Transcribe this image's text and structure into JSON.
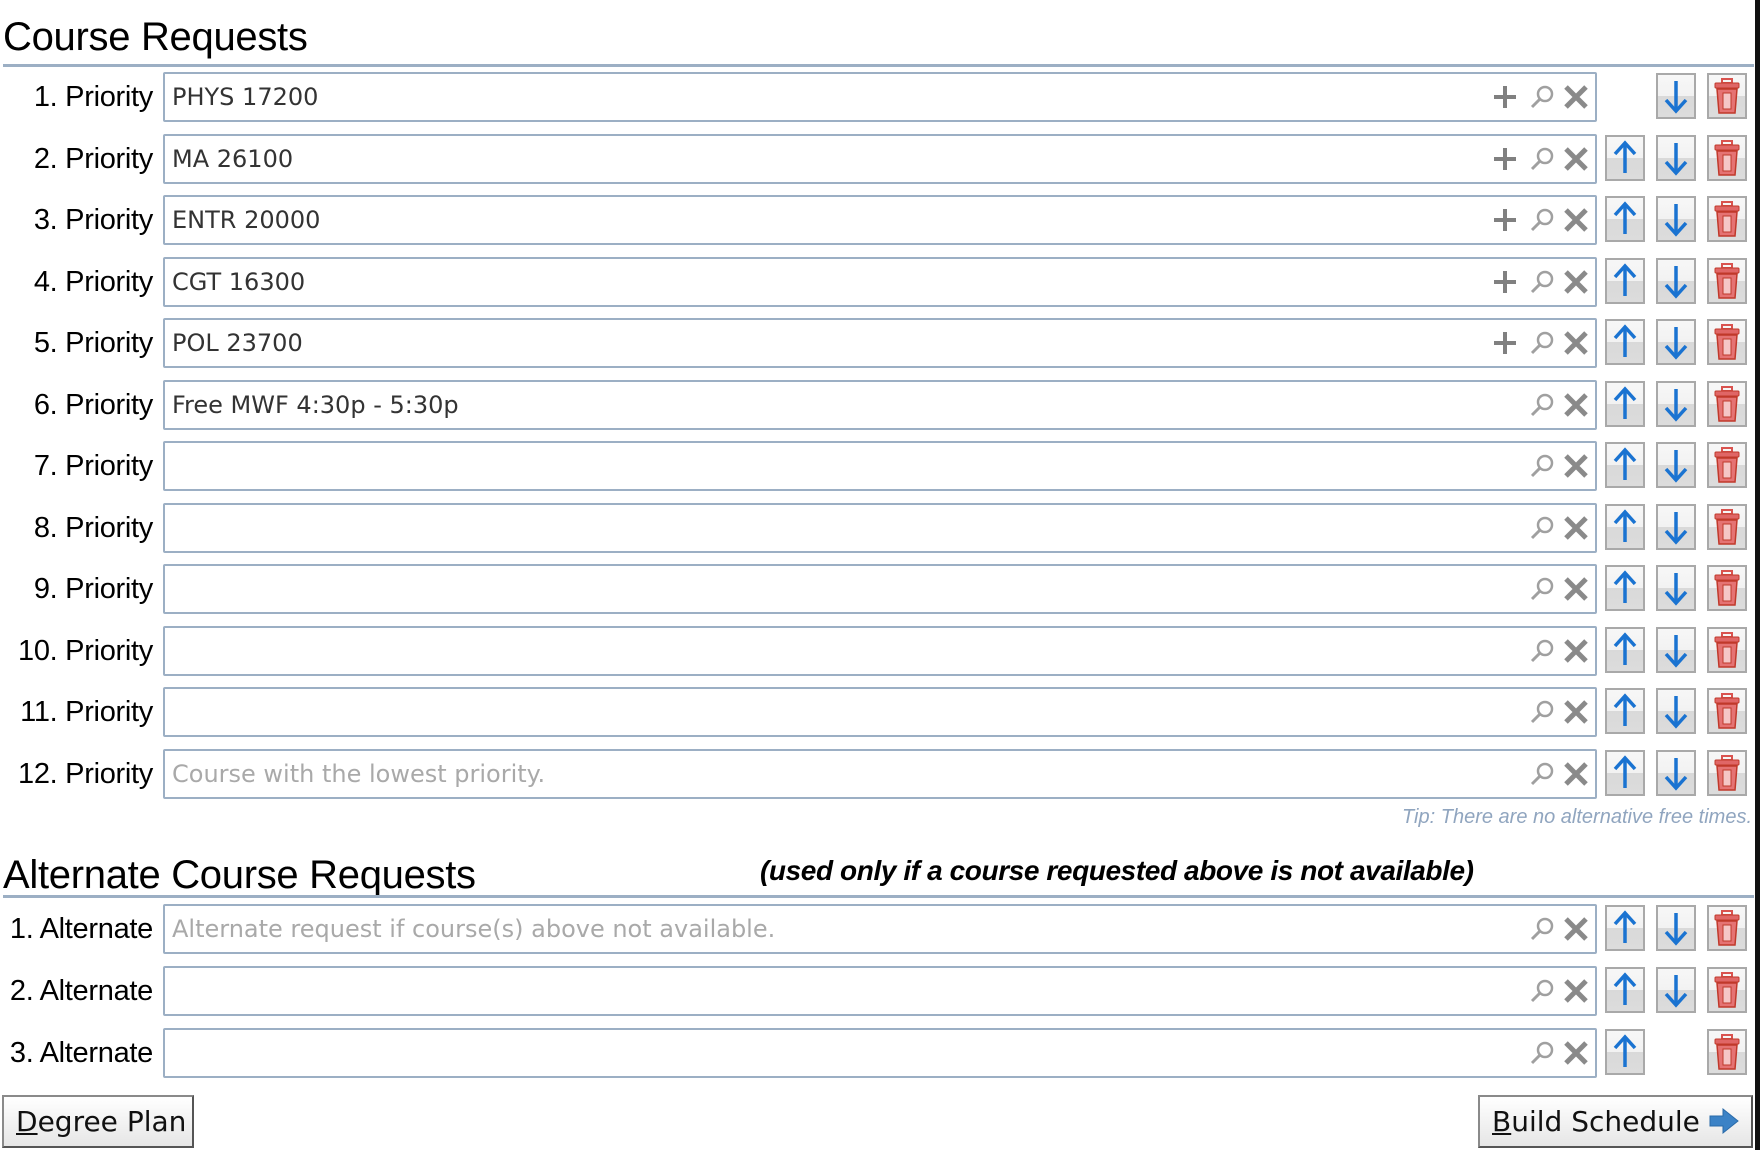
{
  "course_requests": {
    "title": "Course Requests",
    "rows": [
      {
        "label": "1. Priority",
        "value": "PHYS 17200",
        "placeholder": "",
        "has_add": true,
        "has_up": false,
        "has_down": true
      },
      {
        "label": "2. Priority",
        "value": "MA 26100",
        "placeholder": "",
        "has_add": true,
        "has_up": true,
        "has_down": true
      },
      {
        "label": "3. Priority",
        "value": "ENTR 20000",
        "placeholder": "",
        "has_add": true,
        "has_up": true,
        "has_down": true
      },
      {
        "label": "4. Priority",
        "value": "CGT 16300",
        "placeholder": "",
        "has_add": true,
        "has_up": true,
        "has_down": true
      },
      {
        "label": "5. Priority",
        "value": "POL 23700",
        "placeholder": "",
        "has_add": true,
        "has_up": true,
        "has_down": true
      },
      {
        "label": "6. Priority",
        "value": "Free MWF 4:30p - 5:30p",
        "placeholder": "",
        "has_add": false,
        "has_up": true,
        "has_down": true
      },
      {
        "label": "7. Priority",
        "value": "",
        "placeholder": "",
        "has_add": false,
        "has_up": true,
        "has_down": true
      },
      {
        "label": "8. Priority",
        "value": "",
        "placeholder": "",
        "has_add": false,
        "has_up": true,
        "has_down": true
      },
      {
        "label": "9. Priority",
        "value": "",
        "placeholder": "",
        "has_add": false,
        "has_up": true,
        "has_down": true
      },
      {
        "label": "10. Priority",
        "value": "",
        "placeholder": "",
        "has_add": false,
        "has_up": true,
        "has_down": true
      },
      {
        "label": "11. Priority",
        "value": "",
        "placeholder": "",
        "has_add": false,
        "has_up": true,
        "has_down": true
      },
      {
        "label": "12. Priority",
        "value": "",
        "placeholder": "Course with the lowest priority.",
        "has_add": false,
        "has_up": true,
        "has_down": true
      }
    ],
    "tip": "Tip: There are no alternative free times."
  },
  "alternate_requests": {
    "title": "Alternate Course Requests",
    "subtitle": "(used only if a course requested above is not available)",
    "rows": [
      {
        "label": "1. Alternate",
        "value": "",
        "placeholder": "Alternate request if course(s) above not available.",
        "has_add": false,
        "has_up": true,
        "has_down": true
      },
      {
        "label": "2. Alternate",
        "value": "",
        "placeholder": "",
        "has_add": false,
        "has_up": true,
        "has_down": true
      },
      {
        "label": "3. Alternate",
        "value": "",
        "placeholder": "",
        "has_add": false,
        "has_up": true,
        "has_down": false
      }
    ]
  },
  "icons": {
    "add": "plus-icon",
    "search": "search-icon",
    "clear": "clear-x-icon",
    "up": "arrow-up-icon",
    "down": "arrow-down-icon",
    "delete": "trash-icon",
    "next": "arrow-right-icon"
  },
  "colors": {
    "accent_blue": "#1a73d1",
    "delete_red": "#d9534f",
    "border": "#9cafc4",
    "tip": "#90a5bf"
  },
  "footer": {
    "degree_plan": {
      "accesskey": "D",
      "rest": "egree Plan"
    },
    "build_schedule": {
      "accesskey": "B",
      "rest": "uild Schedule"
    }
  }
}
